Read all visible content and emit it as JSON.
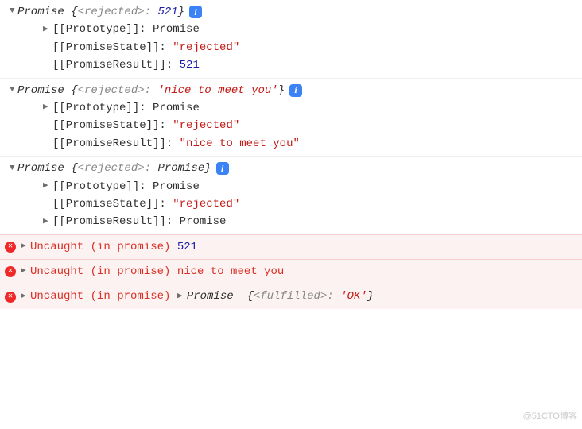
{
  "entries": [
    {
      "label": "Promise",
      "status_word": "<rejected>",
      "result_display": "521",
      "result_kind": "number",
      "children": {
        "proto": "Promise",
        "state": "\"rejected\"",
        "result": "521",
        "result_kind": "number",
        "result_has_arrow": false
      }
    },
    {
      "label": "Promise",
      "status_word": "<rejected>",
      "result_display": "'nice to meet you'",
      "result_kind": "string",
      "children": {
        "proto": "Promise",
        "state": "\"rejected\"",
        "result": "\"nice to meet you\"",
        "result_kind": "string",
        "result_has_arrow": false
      }
    },
    {
      "label": "Promise",
      "status_word": "<rejected>",
      "result_display": "Promise",
      "result_kind": "ident",
      "children": {
        "proto": "Promise",
        "state": "\"rejected\"",
        "result": "Promise",
        "result_kind": "ident",
        "result_has_arrow": true
      }
    }
  ],
  "keys": {
    "proto": "[[Prototype]]:",
    "state": "[[PromiseState]]:",
    "result": "[[PromiseResult]]:"
  },
  "errors": [
    {
      "prefix": "Uncaught (in promise)",
      "value": "521",
      "kind": "number"
    },
    {
      "prefix": "Uncaught (in promise)",
      "value": "nice to meet you",
      "kind": "text"
    },
    {
      "prefix": "Uncaught (in promise)",
      "inline_promise": {
        "label": "Promise",
        "status_word": "<fulfilled>",
        "result": "'OK'"
      }
    }
  ],
  "watermark": "@51CTO博客"
}
